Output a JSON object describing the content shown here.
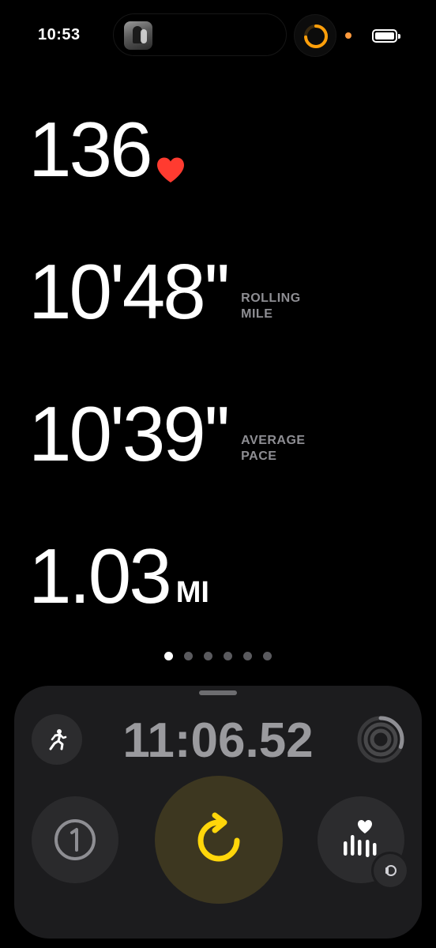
{
  "status_bar": {
    "time": "10:53"
  },
  "metrics": {
    "heart_rate": {
      "value": "136"
    },
    "rolling_mile": {
      "value": "10'48''",
      "label": "ROLLING\nMILE"
    },
    "average_pace": {
      "value": "10'39''",
      "label": "AVERAGE\nPACE"
    },
    "distance": {
      "value": "1.03",
      "unit": "MI"
    }
  },
  "page_indicator": {
    "count": 6,
    "active_index": 0
  },
  "controls": {
    "elapsed_time": "11:06.52",
    "activity_icon": "running-figure-icon",
    "lap_icon": "lap-1-icon",
    "resume_icon": "resume-arrow-icon",
    "metrics_icon": "heart-metrics-icon"
  },
  "colors": {
    "heart": "#ff3b30",
    "accent_yellow": "#ffd60a",
    "battery_dot": "#ff9a3d"
  }
}
